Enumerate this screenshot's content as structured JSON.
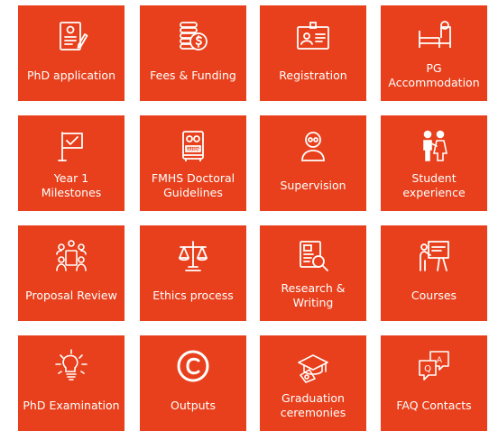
{
  "theme": {
    "tile_color": "#E8401C",
    "icon_color": "#FFFFFF",
    "text_color": "#FFFFFF"
  },
  "tiles": [
    {
      "label": "PhD application",
      "icon": "application-form-icon"
    },
    {
      "label": "Fees & Funding",
      "icon": "coins-dollar-icon"
    },
    {
      "label": "Registration",
      "icon": "id-card-icon"
    },
    {
      "label": "PG\nAccommodation",
      "icon": "bed-icon"
    },
    {
      "label": "Year 1\nMilestones",
      "icon": "flag-check-icon"
    },
    {
      "label": "FMHS Doctoral\nGuidelines",
      "icon": "guide-book-icon"
    },
    {
      "label": "Supervision",
      "icon": "supervisor-icon"
    },
    {
      "label": "Student\nexperience",
      "icon": "two-people-icon"
    },
    {
      "label": "Proposal Review",
      "icon": "meeting-icon"
    },
    {
      "label": "Ethics process",
      "icon": "scales-icon"
    },
    {
      "label": "Research &\nWriting",
      "icon": "document-search-icon"
    },
    {
      "label": "Courses",
      "icon": "presenter-board-icon"
    },
    {
      "label": "PhD Examination",
      "icon": "lightbulb-icon"
    },
    {
      "label": "Outputs",
      "icon": "copyright-icon"
    },
    {
      "label": "Graduation\nceremonies",
      "icon": "graduation-cap-icon"
    },
    {
      "label": "FAQ Contacts",
      "icon": "speech-bubbles-qa-icon"
    }
  ]
}
